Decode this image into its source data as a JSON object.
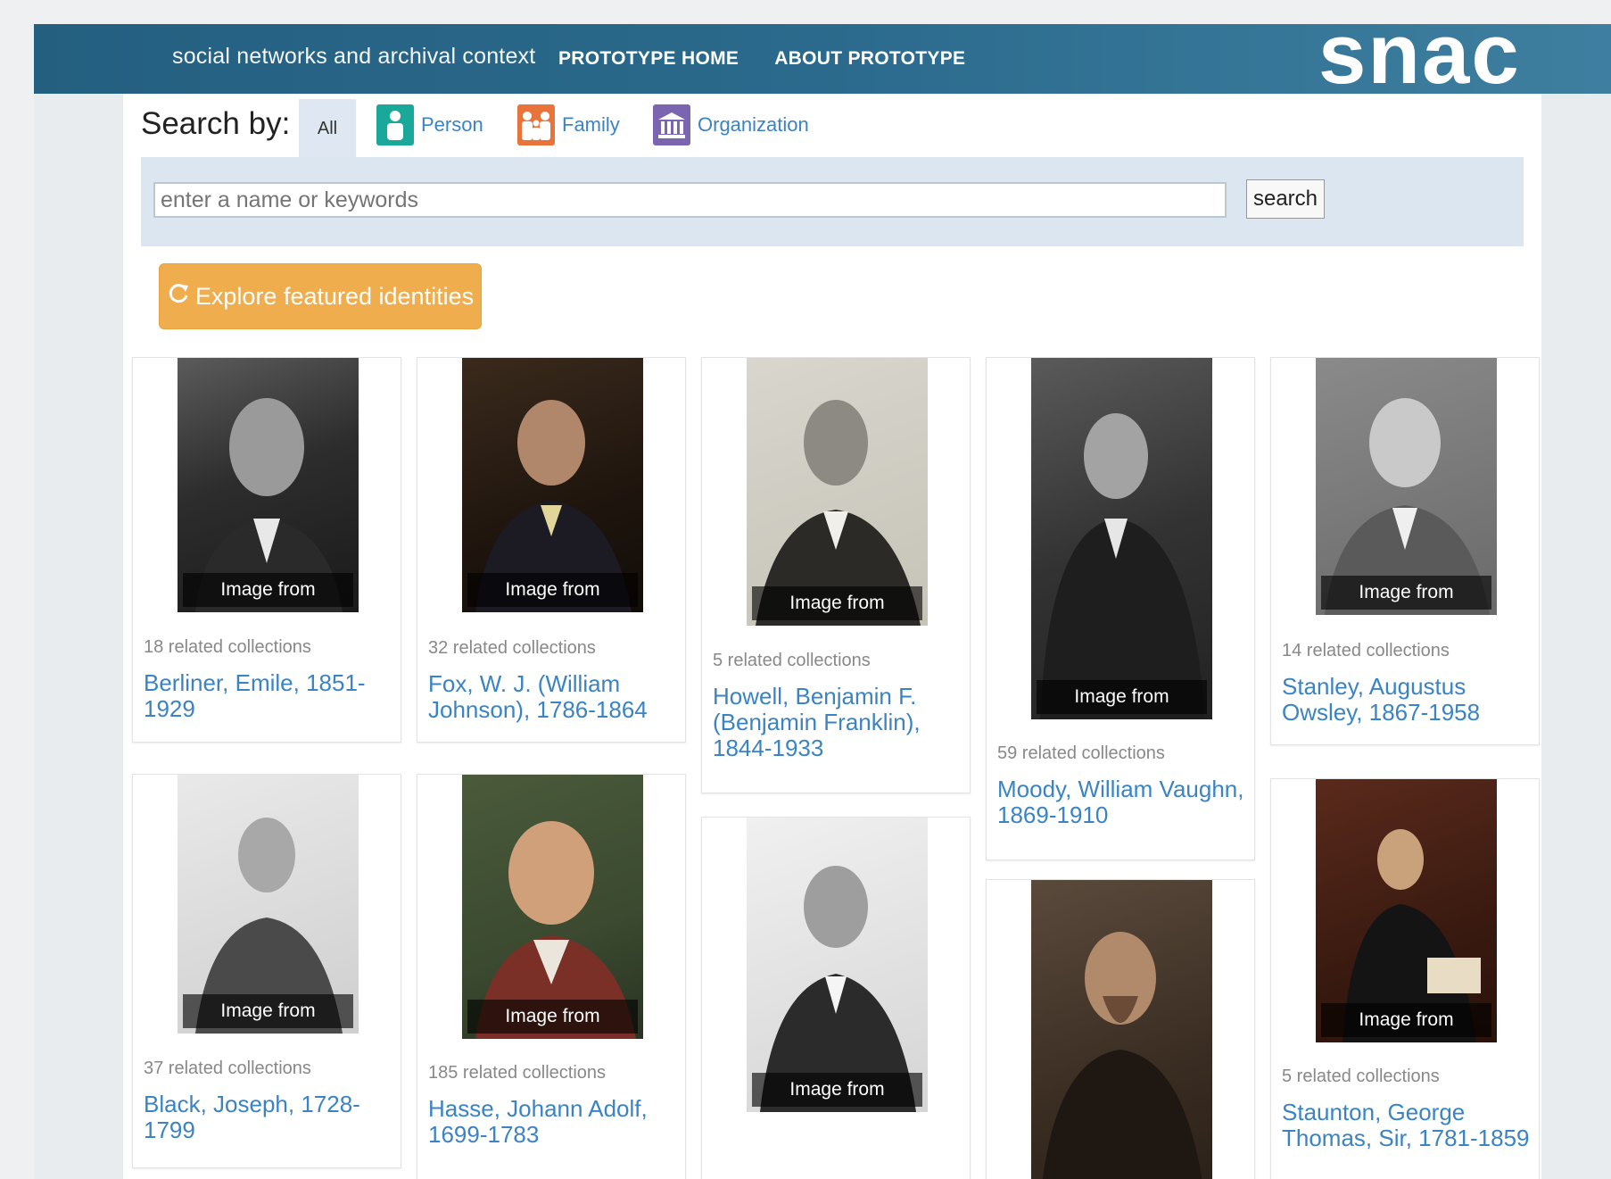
{
  "header": {
    "tagline": "social networks and archival context",
    "nav": [
      "PROTOTYPE HOME",
      "ABOUT PROTOTYPE"
    ],
    "logo": "snac"
  },
  "search": {
    "label": "Search by:",
    "tabs": [
      {
        "label": "All",
        "selected": true
      },
      {
        "label": "Person",
        "icon": "person-icon",
        "color": "#1aa89a"
      },
      {
        "label": "Family",
        "icon": "family-icon",
        "color": "#e8743b"
      },
      {
        "label": "Organization",
        "icon": "organization-icon",
        "color": "#7b64b0"
      }
    ],
    "placeholder": "enter a name or keywords",
    "button": "search"
  },
  "explore": {
    "label": "Explore featured identities",
    "icon": "refresh-icon"
  },
  "cards": [
    {
      "caption": "Image from Wikipedia",
      "count": "18 related collections",
      "name": "Berliner, Emile, 1851-1929"
    },
    {
      "caption": "Image from Wikipedia",
      "count": "32 related collections",
      "name": "Fox, W. J. (William Johnson), 1786-1864"
    },
    {
      "caption": "Image from Wikipedia",
      "count": "5 related collections",
      "name": "Howell, Benjamin F. (Benjamin Franklin), 1844-1933"
    },
    {
      "caption": "Image from Wikipedia",
      "count": "59 related collections",
      "name": "Moody, William Vaughn, 1869-1910"
    },
    {
      "caption": "Image from Wikipedia",
      "count": "14 related collections",
      "name": "Stanley, Augustus Owsley, 1867-1958"
    },
    {
      "caption": "Image from Wikipedia",
      "count": "37 related collections",
      "name": "Black, Joseph, 1728-1799"
    },
    {
      "caption": "Image from Wikipedia",
      "count": "185 related collections",
      "name": "Hasse, Johann Adolf, 1699-1783"
    },
    {
      "caption": "Image from Wikipedia",
      "count": "",
      "name": ""
    },
    {
      "caption": "",
      "count": "",
      "name": ""
    },
    {
      "caption": "Image from Wikipedia",
      "count": "5 related collections",
      "name": "Staunton, George Thomas, Sir, 1781-1859"
    }
  ]
}
